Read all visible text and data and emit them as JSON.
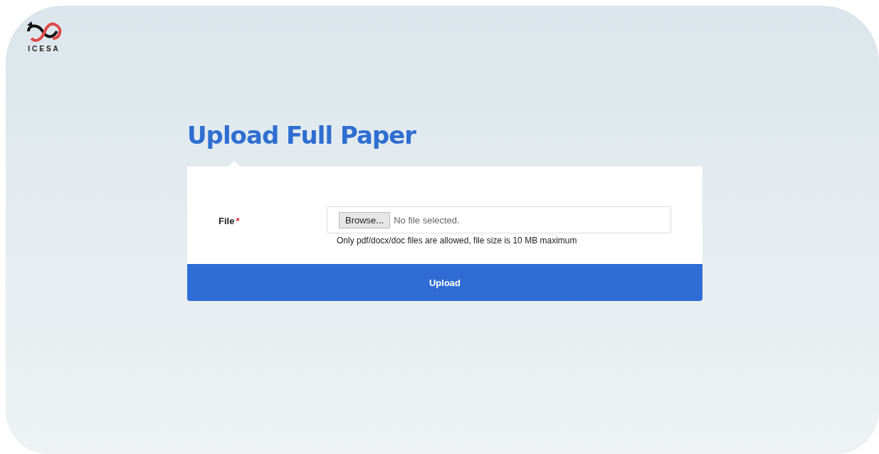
{
  "logo": {
    "text": "ICESA"
  },
  "title": "Upload Full Paper",
  "form": {
    "fields": [
      {
        "label": "File",
        "required": true,
        "required_mark": "*",
        "browse_label": "Browse...",
        "value": "No file selected.",
        "help": "Only pdf/docx/doc files are allowed, file size is 10 MB maximum"
      }
    ],
    "submit": "Upload"
  }
}
